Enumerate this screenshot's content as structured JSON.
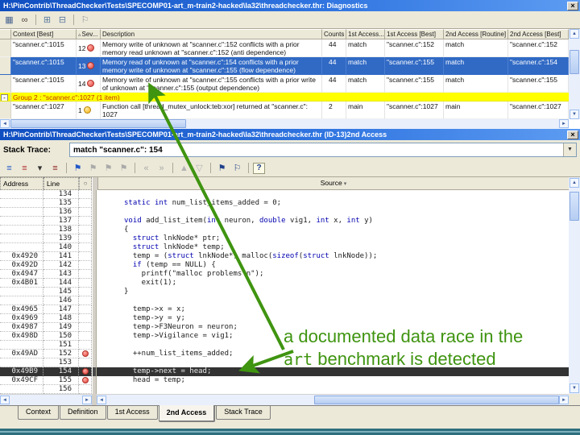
{
  "ui": {
    "close_glyph": "×",
    "arrow_up": "▲",
    "arrow_down": "▼",
    "arrow_left": "◄",
    "arrow_right": "►",
    "combo_arrow": "▼",
    "marker_circle_header": "○",
    "source_sort_glyph": "▾",
    "group_expander": "-"
  },
  "annotation": {
    "line1": "a documented data race in the",
    "code_word": "art",
    "line2_rest": " benchmark is detected",
    "color": "#3f9410"
  },
  "code_keywords": [
    "static",
    "int",
    "void",
    "double",
    "struct",
    "if",
    "sizeof"
  ],
  "diagnostics_window": {
    "title": "H:\\PinContrib\\ThreadChecker\\Tests\\SPECOMP01-art_m-train2-hacked\\Ia32\\threadchecker.thr: Diagnostics",
    "toolbar_icons": [
      {
        "name": "column-fit-icon",
        "glyph": "▦",
        "color": "#49648f"
      },
      {
        "name": "find-binoculars-icon",
        "glyph": "∞",
        "color": "#4a3f38"
      },
      {
        "name": "separator"
      },
      {
        "name": "expand-groups-icon",
        "glyph": "⊞",
        "color": "#5a7aa0"
      },
      {
        "name": "collapse-groups-icon",
        "glyph": "⊟",
        "color": "#5a7aa0"
      },
      {
        "name": "separator"
      },
      {
        "name": "flag-icon",
        "glyph": "⚐",
        "color": "#8d9099"
      }
    ],
    "table": {
      "columns": [
        {
          "label": ""
        },
        {
          "label": "Context [Best]"
        },
        {
          "label": "Sev...",
          "sort": "▵"
        },
        {
          "label": "Description"
        },
        {
          "label": "Counts"
        },
        {
          "label": "1st Access..."
        },
        {
          "label": "1st Access [Best]"
        },
        {
          "label": "2nd Access [Routine]"
        },
        {
          "label": "2nd Access [Best]"
        }
      ],
      "rows": [
        {
          "type": "item",
          "context": "\"scanner.c\":1015",
          "sev": "12",
          "icon": "red",
          "description": "Memory write of unknown at \"scanner.c\":152 conflicts with a prior memory read unknown at \"scanner.c\":152 (anti dependence)",
          "counts": "44",
          "first_routine": "match",
          "first_best": "\"scanner.c\":152",
          "second_routine": "match",
          "second_best": "\"scanner.c\":152",
          "selected": false
        },
        {
          "type": "item",
          "context": "\"scanner.c\":1015",
          "sev": "13",
          "icon": "red",
          "description": "Memory read of unknown at \"scanner.c\":154 conflicts with a prior memory write of unknown at \"scanner.c\":155 (flow dependence)",
          "counts": "44",
          "first_routine": "match",
          "first_best": "\"scanner.c\":155",
          "second_routine": "match",
          "second_best": "\"scanner.c\":154",
          "selected": true
        },
        {
          "type": "item",
          "context": "\"scanner.c\":1015",
          "sev": "14",
          "icon": "red",
          "description": "Memory write of unknown at \"scanner.c\":155 conflicts with a prior write of unknown at \"scanner.c\":155 (output dependence)",
          "counts": "44",
          "first_routine": "match",
          "first_best": "\"scanner.c\":155",
          "second_routine": "match",
          "second_best": "\"scanner.c\":155",
          "selected": false
        },
        {
          "type": "group",
          "label": "Group 2 : \"scanner.c\":1027 (1 item)"
        },
        {
          "type": "item",
          "context": "\"scanner.c\":1027",
          "sev": "1",
          "icon": "yellow",
          "description": "Function call [thread_mutex_unlock:teb:xor] returned at \"scanner.c\": 1027",
          "counts": "2",
          "first_routine": "main",
          "first_best": "\"scanner.c\":1027",
          "second_routine": "main",
          "second_best": "\"scanner.c\":1027",
          "selected": false
        }
      ]
    }
  },
  "access_window": {
    "title": "H:\\PinContrib\\ThreadChecker\\Tests\\SPECOMP01-art_m-train2-hacked\\Ia32\\threadchecker.thr (ID-13)2nd Access",
    "stack_trace_label": "Stack Trace:",
    "stack_trace_value": "match \"scanner.c\": 154",
    "toolbar_icons": [
      {
        "name": "view-list-blue-icon",
        "glyph": "≡",
        "color": "#2458c8"
      },
      {
        "name": "view-list-red-icon",
        "glyph": "≡",
        "color": "#b03030"
      },
      {
        "name": "view-dropdown-icon",
        "glyph": "▾",
        "color": "#333333"
      },
      {
        "name": "view-list-dark-icon",
        "glyph": "≡",
        "color": "#8c2020"
      },
      {
        "name": "separator"
      },
      {
        "name": "bookmark-set-icon",
        "glyph": "⚑",
        "color": "#2458c8"
      },
      {
        "name": "bookmark-next-icon",
        "glyph": "⚑",
        "color": "#aaaaaa"
      },
      {
        "name": "bookmark-prev-icon",
        "glyph": "⚑",
        "color": "#aaaaaa"
      },
      {
        "name": "bookmark-clear-icon",
        "glyph": "⚑",
        "color": "#aaaaaa"
      },
      {
        "name": "separator"
      },
      {
        "name": "prev-access-icon",
        "glyph": "«",
        "color": "#aaaaaa"
      },
      {
        "name": "next-access-icon",
        "glyph": "»",
        "color": "#aaaaaa"
      },
      {
        "name": "separator"
      },
      {
        "name": "filter-up-icon",
        "glyph": "▲",
        "color": "#b4b4b4"
      },
      {
        "name": "filter-down-icon",
        "glyph": "▽",
        "color": "#b4b4b4"
      },
      {
        "name": "separator"
      },
      {
        "name": "goto-source-icon",
        "glyph": "⚑",
        "color": "#20408a"
      },
      {
        "name": "goto-reference-icon",
        "glyph": "⚐",
        "color": "#20408a"
      },
      {
        "name": "separator"
      },
      {
        "name": "help-icon",
        "glyph": "?",
        "color": "#1a3a8a",
        "boxed": true
      }
    ],
    "source_pane": {
      "address_header": "Address",
      "line_header": "Line",
      "source_header": "Source",
      "lines": [
        {
          "line": "134",
          "addr": "",
          "code": ""
        },
        {
          "line": "135",
          "addr": "",
          "code": "static int num_list_items_added = 0;"
        },
        {
          "line": "136",
          "addr": "",
          "code": ""
        },
        {
          "line": "137",
          "addr": "",
          "code": "void add_list_item(int neuron, double vig1, int x, int y)"
        },
        {
          "line": "138",
          "addr": "",
          "code": "{"
        },
        {
          "line": "139",
          "addr": "",
          "code": "  struct lnkNode* ptr;"
        },
        {
          "line": "140",
          "addr": "",
          "code": "  struct lnkNode* temp;"
        },
        {
          "line": "141",
          "addr": "0x4920",
          "code": "  temp = (struct lnkNode*) malloc(sizeof(struct lnkNode));"
        },
        {
          "line": "142",
          "addr": "0x492D",
          "code": "  if (temp == NULL) {"
        },
        {
          "line": "143",
          "addr": "0x4947",
          "code": "    printf(\"malloc problems\\n\");"
        },
        {
          "line": "144",
          "addr": "0x4B01",
          "code": "    exit(1);"
        },
        {
          "line": "145",
          "addr": "",
          "code": "}"
        },
        {
          "line": "146",
          "addr": "",
          "code": ""
        },
        {
          "line": "147",
          "addr": "0x4965",
          "code": "  temp->x = x;"
        },
        {
          "line": "148",
          "addr": "0x4969",
          "code": "  temp->y = y;"
        },
        {
          "line": "149",
          "addr": "0x4987",
          "code": "  temp->F3Neuron = neuron;"
        },
        {
          "line": "150",
          "addr": "0x498D",
          "code": "  temp->Vigilance = vig1;"
        },
        {
          "line": "151",
          "addr": "",
          "code": ""
        },
        {
          "line": "152",
          "addr": "0x49AD",
          "code": "  ++num_list_items_added;",
          "marker": true
        },
        {
          "line": "153",
          "addr": "",
          "code": ""
        },
        {
          "line": "154",
          "addr": "0x49B9",
          "code": "  temp->next = head;",
          "marker": true,
          "highlight": true
        },
        {
          "line": "155",
          "addr": "0x49CF",
          "code": "  head = temp;",
          "marker": true
        },
        {
          "line": "156",
          "addr": "",
          "code": ""
        }
      ]
    },
    "tabs": [
      "Context",
      "Definition",
      "1st Access",
      "2nd Access",
      "Stack Trace"
    ],
    "active_tab": "2nd Access"
  }
}
